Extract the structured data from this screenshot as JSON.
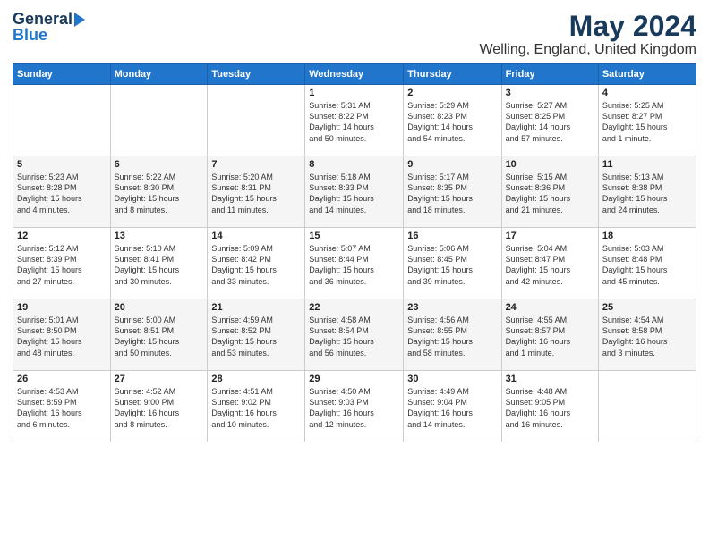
{
  "header": {
    "logo_general": "General",
    "logo_blue": "Blue",
    "month_year": "May 2024",
    "location": "Welling, England, United Kingdom"
  },
  "weekdays": [
    "Sunday",
    "Monday",
    "Tuesday",
    "Wednesday",
    "Thursday",
    "Friday",
    "Saturday"
  ],
  "weeks": [
    [
      {
        "day": "",
        "info": ""
      },
      {
        "day": "",
        "info": ""
      },
      {
        "day": "",
        "info": ""
      },
      {
        "day": "1",
        "info": "Sunrise: 5:31 AM\nSunset: 8:22 PM\nDaylight: 14 hours\nand 50 minutes."
      },
      {
        "day": "2",
        "info": "Sunrise: 5:29 AM\nSunset: 8:23 PM\nDaylight: 14 hours\nand 54 minutes."
      },
      {
        "day": "3",
        "info": "Sunrise: 5:27 AM\nSunset: 8:25 PM\nDaylight: 14 hours\nand 57 minutes."
      },
      {
        "day": "4",
        "info": "Sunrise: 5:25 AM\nSunset: 8:27 PM\nDaylight: 15 hours\nand 1 minute."
      }
    ],
    [
      {
        "day": "5",
        "info": "Sunrise: 5:23 AM\nSunset: 8:28 PM\nDaylight: 15 hours\nand 4 minutes."
      },
      {
        "day": "6",
        "info": "Sunrise: 5:22 AM\nSunset: 8:30 PM\nDaylight: 15 hours\nand 8 minutes."
      },
      {
        "day": "7",
        "info": "Sunrise: 5:20 AM\nSunset: 8:31 PM\nDaylight: 15 hours\nand 11 minutes."
      },
      {
        "day": "8",
        "info": "Sunrise: 5:18 AM\nSunset: 8:33 PM\nDaylight: 15 hours\nand 14 minutes."
      },
      {
        "day": "9",
        "info": "Sunrise: 5:17 AM\nSunset: 8:35 PM\nDaylight: 15 hours\nand 18 minutes."
      },
      {
        "day": "10",
        "info": "Sunrise: 5:15 AM\nSunset: 8:36 PM\nDaylight: 15 hours\nand 21 minutes."
      },
      {
        "day": "11",
        "info": "Sunrise: 5:13 AM\nSunset: 8:38 PM\nDaylight: 15 hours\nand 24 minutes."
      }
    ],
    [
      {
        "day": "12",
        "info": "Sunrise: 5:12 AM\nSunset: 8:39 PM\nDaylight: 15 hours\nand 27 minutes."
      },
      {
        "day": "13",
        "info": "Sunrise: 5:10 AM\nSunset: 8:41 PM\nDaylight: 15 hours\nand 30 minutes."
      },
      {
        "day": "14",
        "info": "Sunrise: 5:09 AM\nSunset: 8:42 PM\nDaylight: 15 hours\nand 33 minutes."
      },
      {
        "day": "15",
        "info": "Sunrise: 5:07 AM\nSunset: 8:44 PM\nDaylight: 15 hours\nand 36 minutes."
      },
      {
        "day": "16",
        "info": "Sunrise: 5:06 AM\nSunset: 8:45 PM\nDaylight: 15 hours\nand 39 minutes."
      },
      {
        "day": "17",
        "info": "Sunrise: 5:04 AM\nSunset: 8:47 PM\nDaylight: 15 hours\nand 42 minutes."
      },
      {
        "day": "18",
        "info": "Sunrise: 5:03 AM\nSunset: 8:48 PM\nDaylight: 15 hours\nand 45 minutes."
      }
    ],
    [
      {
        "day": "19",
        "info": "Sunrise: 5:01 AM\nSunset: 8:50 PM\nDaylight: 15 hours\nand 48 minutes."
      },
      {
        "day": "20",
        "info": "Sunrise: 5:00 AM\nSunset: 8:51 PM\nDaylight: 15 hours\nand 50 minutes."
      },
      {
        "day": "21",
        "info": "Sunrise: 4:59 AM\nSunset: 8:52 PM\nDaylight: 15 hours\nand 53 minutes."
      },
      {
        "day": "22",
        "info": "Sunrise: 4:58 AM\nSunset: 8:54 PM\nDaylight: 15 hours\nand 56 minutes."
      },
      {
        "day": "23",
        "info": "Sunrise: 4:56 AM\nSunset: 8:55 PM\nDaylight: 15 hours\nand 58 minutes."
      },
      {
        "day": "24",
        "info": "Sunrise: 4:55 AM\nSunset: 8:57 PM\nDaylight: 16 hours\nand 1 minute."
      },
      {
        "day": "25",
        "info": "Sunrise: 4:54 AM\nSunset: 8:58 PM\nDaylight: 16 hours\nand 3 minutes."
      }
    ],
    [
      {
        "day": "26",
        "info": "Sunrise: 4:53 AM\nSunset: 8:59 PM\nDaylight: 16 hours\nand 6 minutes."
      },
      {
        "day": "27",
        "info": "Sunrise: 4:52 AM\nSunset: 9:00 PM\nDaylight: 16 hours\nand 8 minutes."
      },
      {
        "day": "28",
        "info": "Sunrise: 4:51 AM\nSunset: 9:02 PM\nDaylight: 16 hours\nand 10 minutes."
      },
      {
        "day": "29",
        "info": "Sunrise: 4:50 AM\nSunset: 9:03 PM\nDaylight: 16 hours\nand 12 minutes."
      },
      {
        "day": "30",
        "info": "Sunrise: 4:49 AM\nSunset: 9:04 PM\nDaylight: 16 hours\nand 14 minutes."
      },
      {
        "day": "31",
        "info": "Sunrise: 4:48 AM\nSunset: 9:05 PM\nDaylight: 16 hours\nand 16 minutes."
      },
      {
        "day": "",
        "info": ""
      }
    ]
  ]
}
